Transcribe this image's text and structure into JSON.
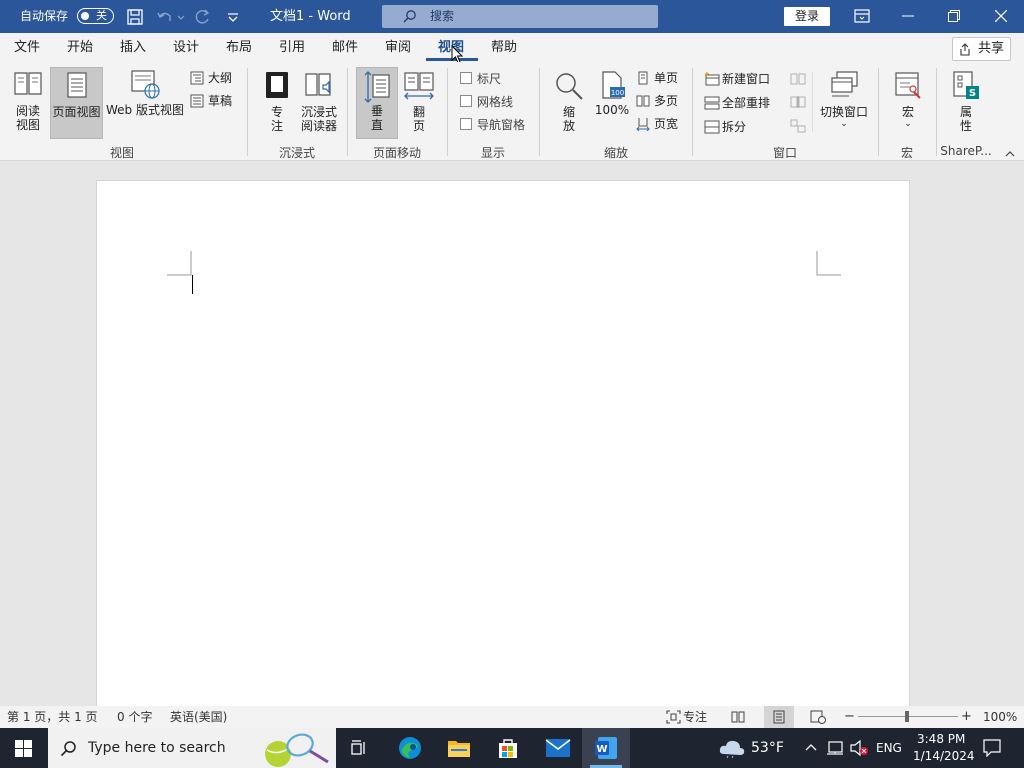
{
  "titlebar": {
    "autosave_label": "自动保存",
    "autosave_state": "关",
    "doc_title": "文档1  -  Word",
    "search_placeholder": "搜索",
    "login_label": "登录"
  },
  "menu": {
    "tabs": [
      "文件",
      "开始",
      "插入",
      "设计",
      "布局",
      "引用",
      "邮件",
      "审阅",
      "视图",
      "帮助"
    ],
    "active_tab": "视图",
    "share_label": "共享"
  },
  "ribbon": {
    "views": {
      "group_label": "视图",
      "read_mode": "阅读\n视图",
      "print_layout": "页面视图",
      "web_layout": "Web 版式视图",
      "outline": "大纲",
      "draft": "草稿"
    },
    "immersive": {
      "group_label": "沉浸式",
      "focus": "专\n注",
      "immersive_reader": "沉浸式\n阅读器"
    },
    "page_movement": {
      "group_label": "页面移动",
      "vertical": "垂\n直",
      "side_to_side": "翻\n页"
    },
    "show": {
      "group_label": "显示",
      "ruler": "标尺",
      "gridlines": "网格线",
      "nav_pane": "导航窗格"
    },
    "zoom": {
      "group_label": "缩放",
      "zoom": "缩\n放",
      "zoom_100": "100%",
      "one_page": "单页",
      "multiple_pages": "多页",
      "page_width": "页宽"
    },
    "window": {
      "group_label": "窗口",
      "new_window": "新建窗口",
      "arrange_all": "全部重排",
      "split": "拆分",
      "switch_windows": "切换窗口"
    },
    "macros": {
      "group_label": "宏",
      "macros": "宏"
    },
    "sharepoint": {
      "group_label": "ShareP...",
      "properties": "属\n性"
    }
  },
  "statusbar": {
    "page_info": "第 1 页，共 1 页",
    "word_count": "0 个字",
    "language": "英语(美国)",
    "focus": "专注",
    "zoom_level": "100%"
  },
  "taskbar": {
    "search_placeholder": "Type here to search",
    "weather": "53°F",
    "lang": "ENG",
    "time": "3:48 PM",
    "date": "1/14/2024"
  }
}
